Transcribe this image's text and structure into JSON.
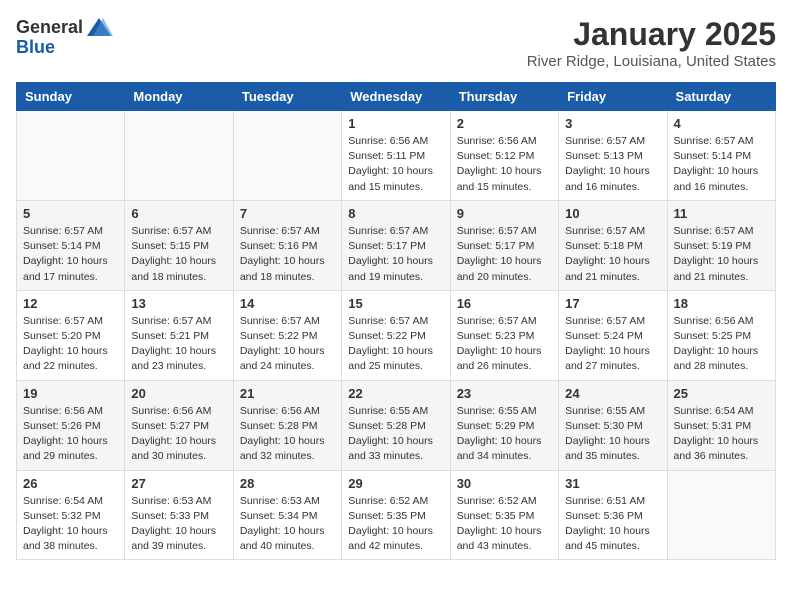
{
  "logo": {
    "general": "General",
    "blue": "Blue"
  },
  "header": {
    "month": "January 2025",
    "location": "River Ridge, Louisiana, United States"
  },
  "weekdays": [
    "Sunday",
    "Monday",
    "Tuesday",
    "Wednesday",
    "Thursday",
    "Friday",
    "Saturday"
  ],
  "weeks": [
    [
      {
        "day": "",
        "info": ""
      },
      {
        "day": "",
        "info": ""
      },
      {
        "day": "",
        "info": ""
      },
      {
        "day": "1",
        "info": "Sunrise: 6:56 AM\nSunset: 5:11 PM\nDaylight: 10 hours and 15 minutes."
      },
      {
        "day": "2",
        "info": "Sunrise: 6:56 AM\nSunset: 5:12 PM\nDaylight: 10 hours and 15 minutes."
      },
      {
        "day": "3",
        "info": "Sunrise: 6:57 AM\nSunset: 5:13 PM\nDaylight: 10 hours and 16 minutes."
      },
      {
        "day": "4",
        "info": "Sunrise: 6:57 AM\nSunset: 5:14 PM\nDaylight: 10 hours and 16 minutes."
      }
    ],
    [
      {
        "day": "5",
        "info": "Sunrise: 6:57 AM\nSunset: 5:14 PM\nDaylight: 10 hours and 17 minutes."
      },
      {
        "day": "6",
        "info": "Sunrise: 6:57 AM\nSunset: 5:15 PM\nDaylight: 10 hours and 18 minutes."
      },
      {
        "day": "7",
        "info": "Sunrise: 6:57 AM\nSunset: 5:16 PM\nDaylight: 10 hours and 18 minutes."
      },
      {
        "day": "8",
        "info": "Sunrise: 6:57 AM\nSunset: 5:17 PM\nDaylight: 10 hours and 19 minutes."
      },
      {
        "day": "9",
        "info": "Sunrise: 6:57 AM\nSunset: 5:17 PM\nDaylight: 10 hours and 20 minutes."
      },
      {
        "day": "10",
        "info": "Sunrise: 6:57 AM\nSunset: 5:18 PM\nDaylight: 10 hours and 21 minutes."
      },
      {
        "day": "11",
        "info": "Sunrise: 6:57 AM\nSunset: 5:19 PM\nDaylight: 10 hours and 21 minutes."
      }
    ],
    [
      {
        "day": "12",
        "info": "Sunrise: 6:57 AM\nSunset: 5:20 PM\nDaylight: 10 hours and 22 minutes."
      },
      {
        "day": "13",
        "info": "Sunrise: 6:57 AM\nSunset: 5:21 PM\nDaylight: 10 hours and 23 minutes."
      },
      {
        "day": "14",
        "info": "Sunrise: 6:57 AM\nSunset: 5:22 PM\nDaylight: 10 hours and 24 minutes."
      },
      {
        "day": "15",
        "info": "Sunrise: 6:57 AM\nSunset: 5:22 PM\nDaylight: 10 hours and 25 minutes."
      },
      {
        "day": "16",
        "info": "Sunrise: 6:57 AM\nSunset: 5:23 PM\nDaylight: 10 hours and 26 minutes."
      },
      {
        "day": "17",
        "info": "Sunrise: 6:57 AM\nSunset: 5:24 PM\nDaylight: 10 hours and 27 minutes."
      },
      {
        "day": "18",
        "info": "Sunrise: 6:56 AM\nSunset: 5:25 PM\nDaylight: 10 hours and 28 minutes."
      }
    ],
    [
      {
        "day": "19",
        "info": "Sunrise: 6:56 AM\nSunset: 5:26 PM\nDaylight: 10 hours and 29 minutes."
      },
      {
        "day": "20",
        "info": "Sunrise: 6:56 AM\nSunset: 5:27 PM\nDaylight: 10 hours and 30 minutes."
      },
      {
        "day": "21",
        "info": "Sunrise: 6:56 AM\nSunset: 5:28 PM\nDaylight: 10 hours and 32 minutes."
      },
      {
        "day": "22",
        "info": "Sunrise: 6:55 AM\nSunset: 5:28 PM\nDaylight: 10 hours and 33 minutes."
      },
      {
        "day": "23",
        "info": "Sunrise: 6:55 AM\nSunset: 5:29 PM\nDaylight: 10 hours and 34 minutes."
      },
      {
        "day": "24",
        "info": "Sunrise: 6:55 AM\nSunset: 5:30 PM\nDaylight: 10 hours and 35 minutes."
      },
      {
        "day": "25",
        "info": "Sunrise: 6:54 AM\nSunset: 5:31 PM\nDaylight: 10 hours and 36 minutes."
      }
    ],
    [
      {
        "day": "26",
        "info": "Sunrise: 6:54 AM\nSunset: 5:32 PM\nDaylight: 10 hours and 38 minutes."
      },
      {
        "day": "27",
        "info": "Sunrise: 6:53 AM\nSunset: 5:33 PM\nDaylight: 10 hours and 39 minutes."
      },
      {
        "day": "28",
        "info": "Sunrise: 6:53 AM\nSunset: 5:34 PM\nDaylight: 10 hours and 40 minutes."
      },
      {
        "day": "29",
        "info": "Sunrise: 6:52 AM\nSunset: 5:35 PM\nDaylight: 10 hours and 42 minutes."
      },
      {
        "day": "30",
        "info": "Sunrise: 6:52 AM\nSunset: 5:35 PM\nDaylight: 10 hours and 43 minutes."
      },
      {
        "day": "31",
        "info": "Sunrise: 6:51 AM\nSunset: 5:36 PM\nDaylight: 10 hours and 45 minutes."
      },
      {
        "day": "",
        "info": ""
      }
    ]
  ]
}
